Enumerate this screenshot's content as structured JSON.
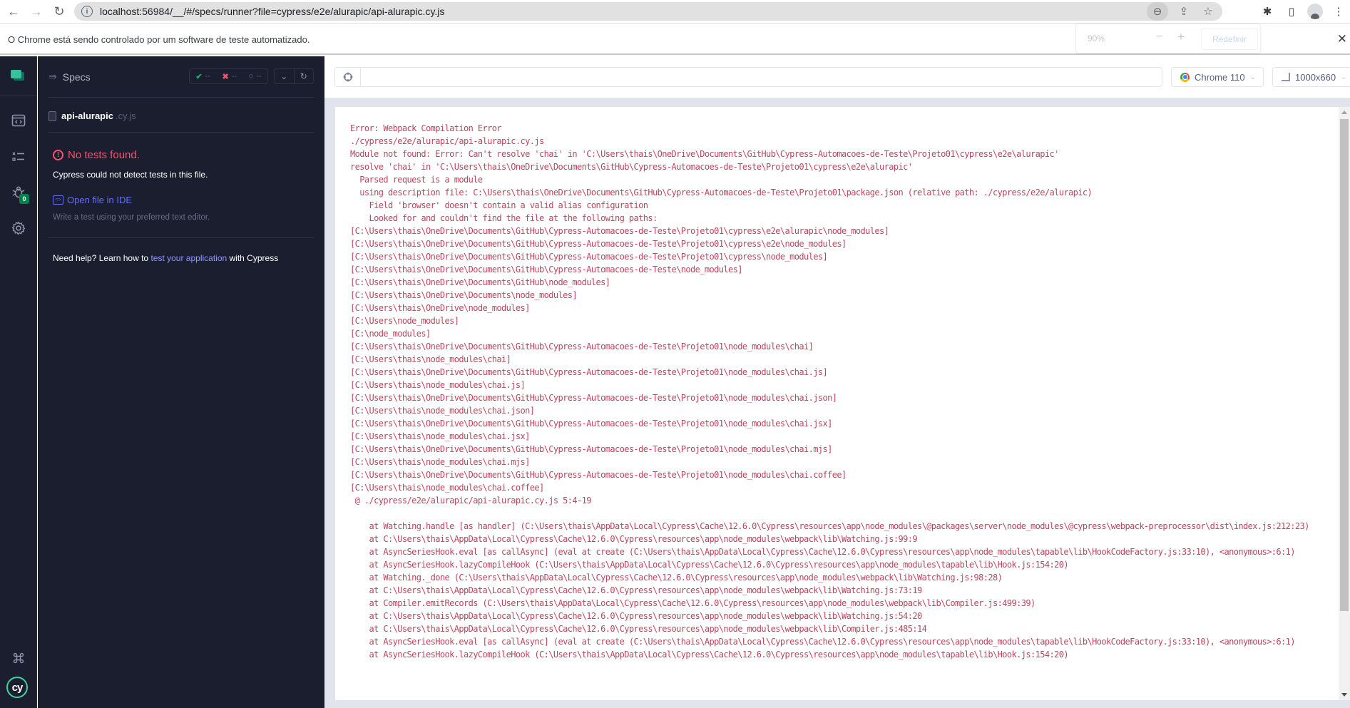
{
  "browser": {
    "url": "localhost:56984/__/#/specs/runner?file=cypress/e2e/alurapic/api-alurapic.cy.js",
    "infobar_message": "O Chrome está sendo controlado por um software de teste automatizado.",
    "zoom_popup": {
      "level": "90%",
      "minus": "−",
      "plus": "+",
      "reset_label": "Redefinir"
    },
    "icons": {
      "back": "←",
      "forward": "→",
      "reload": "↻",
      "info": "i",
      "zoom": "⊖",
      "share": "⇪",
      "star": "☆",
      "extensions": "✱",
      "sidepanel": "▯",
      "menu": "⋮",
      "close": "✕"
    }
  },
  "sidebar": {
    "badge_count": "0",
    "logo_text": "cy"
  },
  "specs": {
    "title": "Specs",
    "stats": {
      "passed_icon": "✔",
      "passed": "--",
      "failed_icon": "✖",
      "failed": "--",
      "pending_icon": "◌",
      "pending": "--"
    },
    "file": {
      "name": "api-alurapic",
      "ext": ".cy.js"
    },
    "no_tests_title": "No tests found.",
    "no_tests_desc": "Cypress could not detect tests in this file.",
    "open_ide_label": "Open file in IDE",
    "write_test_hint": "Write a test using your preferred text editor.",
    "help": {
      "prefix": "Need help? Learn how to ",
      "link": "test your application",
      "suffix": " with Cypress"
    }
  },
  "runner": {
    "url_value": "",
    "browser_label": "Chrome 110",
    "viewport_label": "1000x660"
  },
  "error_output": "Error: Webpack Compilation Error\n./cypress/e2e/alurapic/api-alurapic.cy.js\nModule not found: Error: Can't resolve 'chai' in 'C:\\Users\\thais\\OneDrive\\Documents\\GitHub\\Cypress-Automacoes-de-Teste\\Projeto01\\cypress\\e2e\\alurapic'\nresolve 'chai' in 'C:\\Users\\thais\\OneDrive\\Documents\\GitHub\\Cypress-Automacoes-de-Teste\\Projeto01\\cypress\\e2e\\alurapic'\n  Parsed request is a module\n  using description file: C:\\Users\\thais\\OneDrive\\Documents\\GitHub\\Cypress-Automacoes-de-Teste\\Projeto01\\package.json (relative path: ./cypress/e2e/alurapic)\n    Field 'browser' doesn't contain a valid alias configuration\n    Looked for and couldn't find the file at the following paths:\n[C:\\Users\\thais\\OneDrive\\Documents\\GitHub\\Cypress-Automacoes-de-Teste\\Projeto01\\cypress\\e2e\\alurapic\\node_modules]\n[C:\\Users\\thais\\OneDrive\\Documents\\GitHub\\Cypress-Automacoes-de-Teste\\Projeto01\\cypress\\e2e\\node_modules]\n[C:\\Users\\thais\\OneDrive\\Documents\\GitHub\\Cypress-Automacoes-de-Teste\\Projeto01\\cypress\\node_modules]\n[C:\\Users\\thais\\OneDrive\\Documents\\GitHub\\Cypress-Automacoes-de-Teste\\node_modules]\n[C:\\Users\\thais\\OneDrive\\Documents\\GitHub\\node_modules]\n[C:\\Users\\thais\\OneDrive\\Documents\\node_modules]\n[C:\\Users\\thais\\OneDrive\\node_modules]\n[C:\\Users\\node_modules]\n[C:\\node_modules]\n[C:\\Users\\thais\\OneDrive\\Documents\\GitHub\\Cypress-Automacoes-de-Teste\\Projeto01\\node_modules\\chai]\n[C:\\Users\\thais\\node_modules\\chai]\n[C:\\Users\\thais\\OneDrive\\Documents\\GitHub\\Cypress-Automacoes-de-Teste\\Projeto01\\node_modules\\chai.js]\n[C:\\Users\\thais\\node_modules\\chai.js]\n[C:\\Users\\thais\\OneDrive\\Documents\\GitHub\\Cypress-Automacoes-de-Teste\\Projeto01\\node_modules\\chai.json]\n[C:\\Users\\thais\\node_modules\\chai.json]\n[C:\\Users\\thais\\OneDrive\\Documents\\GitHub\\Cypress-Automacoes-de-Teste\\Projeto01\\node_modules\\chai.jsx]\n[C:\\Users\\thais\\node_modules\\chai.jsx]\n[C:\\Users\\thais\\OneDrive\\Documents\\GitHub\\Cypress-Automacoes-de-Teste\\Projeto01\\node_modules\\chai.mjs]\n[C:\\Users\\thais\\node_modules\\chai.mjs]\n[C:\\Users\\thais\\OneDrive\\Documents\\GitHub\\Cypress-Automacoes-de-Teste\\Projeto01\\node_modules\\chai.coffee]\n[C:\\Users\\thais\\node_modules\\chai.coffee]\n @ ./cypress/e2e/alurapic/api-alurapic.cy.js 5:4-19\n\n    at Watching.handle [as handler] (C:\\Users\\thais\\AppData\\Local\\Cypress\\Cache\\12.6.0\\Cypress\\resources\\app\\node_modules\\@packages\\server\\node_modules\\@cypress\\webpack-preprocessor\\dist\\index.js:212:23)\n    at C:\\Users\\thais\\AppData\\Local\\Cypress\\Cache\\12.6.0\\Cypress\\resources\\app\\node_modules\\webpack\\lib\\Watching.js:99:9\n    at AsyncSeriesHook.eval [as callAsync] (eval at create (C:\\Users\\thais\\AppData\\Local\\Cypress\\Cache\\12.6.0\\Cypress\\resources\\app\\node_modules\\tapable\\lib\\HookCodeFactory.js:33:10), <anonymous>:6:1)\n    at AsyncSeriesHook.lazyCompileHook (C:\\Users\\thais\\AppData\\Local\\Cypress\\Cache\\12.6.0\\Cypress\\resources\\app\\node_modules\\tapable\\lib\\Hook.js:154:20)\n    at Watching._done (C:\\Users\\thais\\AppData\\Local\\Cypress\\Cache\\12.6.0\\Cypress\\resources\\app\\node_modules\\webpack\\lib\\Watching.js:98:28)\n    at C:\\Users\\thais\\AppData\\Local\\Cypress\\Cache\\12.6.0\\Cypress\\resources\\app\\node_modules\\webpack\\lib\\Watching.js:73:19\n    at Compiler.emitRecords (C:\\Users\\thais\\AppData\\Local\\Cypress\\Cache\\12.6.0\\Cypress\\resources\\app\\node_modules\\webpack\\lib\\Compiler.js:499:39)\n    at C:\\Users\\thais\\AppData\\Local\\Cypress\\Cache\\12.6.0\\Cypress\\resources\\app\\node_modules\\webpack\\lib\\Watching.js:54:20\n    at C:\\Users\\thais\\AppData\\Local\\Cypress\\Cache\\12.6.0\\Cypress\\resources\\app\\node_modules\\webpack\\lib\\Compiler.js:485:14\n    at AsyncSeriesHook.eval [as callAsync] (eval at create (C:\\Users\\thais\\AppData\\Local\\Cypress\\Cache\\12.6.0\\Cypress\\resources\\app\\node_modules\\tapable\\lib\\HookCodeFactory.js:33:10), <anonymous>:6:1)\n    at AsyncSeriesHook.lazyCompileHook (C:\\Users\\thais\\AppData\\Local\\Cypress\\Cache\\12.6.0\\Cypress\\resources\\app\\node_modules\\tapable\\lib\\Hook.js:154:20)",
  "colors": {
    "sidebar_bg": "#1b1e2e",
    "error_text": "#c0435d",
    "no_tests_red": "#f4556f",
    "link_indigo": "#6470f3",
    "badge_green": "#00814d",
    "brand_green": "#34c39b"
  }
}
